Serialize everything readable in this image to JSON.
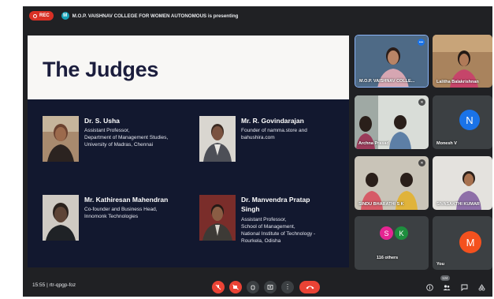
{
  "topbar": {
    "rec_label": "REC",
    "presenter_initial": "M",
    "presenter_text": "M.O.P. VAISHNAV COLLEGE FOR WOMEN AUTONOMOUS is presenting"
  },
  "slide": {
    "title": "The Judges",
    "judges": [
      {
        "name": "Dr. S. Usha",
        "lines": [
          "Assistant Professor,",
          "Department of Management Studies,",
          "University of Madras, Chennai"
        ]
      },
      {
        "name": "Mr. R. Govindarajan",
        "lines": [
          "Founder of namma.store and",
          "bahushira.com"
        ]
      },
      {
        "name": "Mr. Kathiresan Mahendran",
        "lines": [
          "Co-founder and Business Head,",
          "Innomonk Technologies"
        ]
      },
      {
        "name_line1": "Dr. Manvendra Pratap",
        "name_line2": "Singh",
        "lines": [
          "Assistant Professor,",
          "School of Management,",
          "National Institute of Technology -",
          "Rourkela, Odisha"
        ]
      }
    ]
  },
  "participants": {
    "tiles": [
      {
        "label": "M.O.P. VAISHNAV COLLE..."
      },
      {
        "label": "Lalitha Balakrishnan"
      },
      {
        "label": "Archna Prasad"
      },
      {
        "label": "Monesh V",
        "initial": "N"
      },
      {
        "label": "SINDU BHARATHI S K"
      },
      {
        "label": "SIVASAKTHI KUMAR"
      },
      {
        "label": "116 others",
        "initials": [
          "S",
          "K"
        ]
      },
      {
        "label": "You",
        "initial": "M"
      }
    ]
  },
  "bottombar": {
    "meeting_info": "15:55  |  rtr-qpgp-foz",
    "people_count": "124",
    "colors": {
      "end_call": "#ea4335",
      "muted": "#ea4335"
    }
  }
}
